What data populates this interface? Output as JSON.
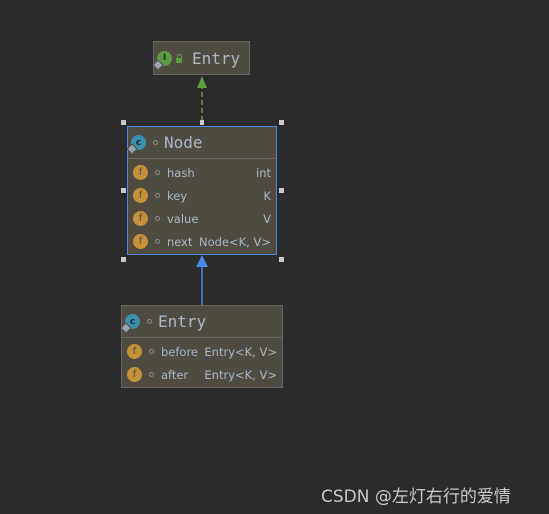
{
  "diagram": {
    "nodes": [
      {
        "id": "entry-interface",
        "kind": "interface",
        "icon": "interface-icon",
        "icon_letter": "I",
        "title": "Entry",
        "fields": []
      },
      {
        "id": "node-class",
        "kind": "class",
        "icon": "class-icon",
        "icon_letter": "c",
        "title": "Node",
        "selected": true,
        "fields": [
          {
            "name": "hash",
            "type": "int"
          },
          {
            "name": "key",
            "type": "K"
          },
          {
            "name": "value",
            "type": "V"
          },
          {
            "name": "next",
            "type": "Node<K, V>"
          }
        ]
      },
      {
        "id": "entry-class",
        "kind": "class",
        "icon": "class-icon",
        "icon_letter": "c",
        "title": "Entry",
        "fields": [
          {
            "name": "before",
            "type": "Entry<K, V>"
          },
          {
            "name": "after",
            "type": "Entry<K, V>"
          }
        ]
      }
    ],
    "edges": [
      {
        "from": "node-class",
        "to": "entry-interface",
        "type": "implements",
        "color": "#5d9b40"
      },
      {
        "from": "entry-class",
        "to": "node-class",
        "type": "extends",
        "color": "#4a88ec"
      }
    ],
    "field_icon_letter": "f"
  },
  "watermark": "CSDN @左灯右行的爱情"
}
